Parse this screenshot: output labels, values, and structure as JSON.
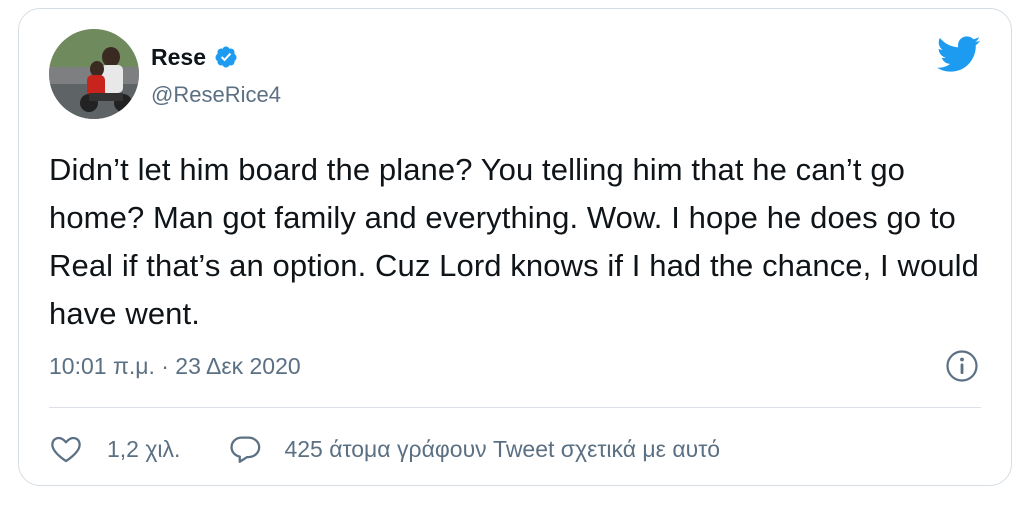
{
  "author": {
    "display_name": "Rese",
    "handle": "@ReseRice4",
    "verified": true
  },
  "tweet": {
    "text": "Didn’t let him board the plane? You telling him that he can’t go home? Man got family and everything. Wow. I hope he does go to Real if that’s an option. Cuz Lord knows if I had the chance, I would have went.",
    "timestamp": "10:01 π.μ. · 23 Δεκ 2020"
  },
  "actions": {
    "like_count": "1,2 χιλ.",
    "reply_label": "425 άτομα γράφουν Tweet σχετικά με αυτό"
  },
  "icons": {
    "like": "heart-icon",
    "reply": "speech-bubble-icon",
    "info": "info-icon",
    "brand": "twitter-bird-icon",
    "verified": "verified-badge-icon"
  },
  "colors": {
    "brand_blue": "#1d9bf0",
    "text_primary": "#0f1419",
    "text_secondary": "#5b7083",
    "border": "#d6dde3"
  }
}
